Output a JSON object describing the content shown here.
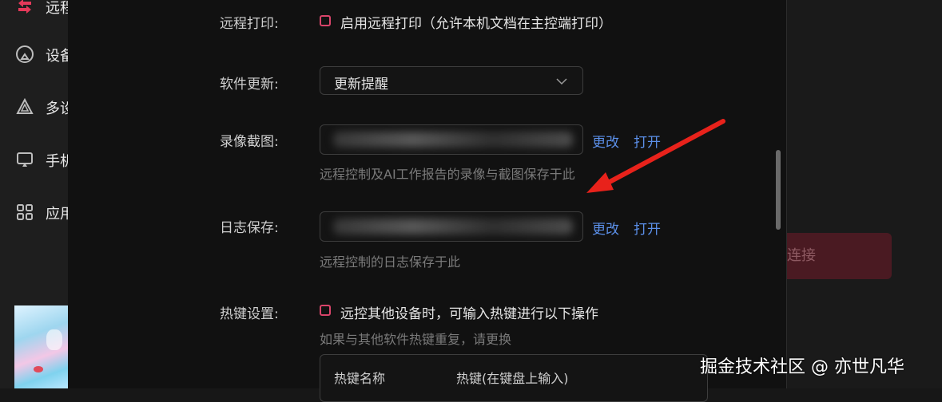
{
  "sidebar": {
    "items": [
      {
        "label": "远程",
        "icon": "remote-arrows-icon",
        "active": true
      },
      {
        "label": "设备",
        "icon": "device-broadcast-icon"
      },
      {
        "label": "多设",
        "icon": "multi-device-triangle-icon"
      },
      {
        "label": "手机",
        "icon": "screen-cast-icon"
      },
      {
        "label": "应用",
        "icon": "apps-grid-icon"
      }
    ]
  },
  "background": {
    "connect_button_label": "连接"
  },
  "settings": {
    "remote_print": {
      "label": "远程打印:",
      "checkbox_text": "启用远程打印（允许本机文档在主控端打印）",
      "checked": false
    },
    "software_update": {
      "label": "软件更新:",
      "selected": "更新提醒"
    },
    "recording": {
      "label": "录像截图:",
      "change": "更改",
      "open": "打开",
      "hint": "远程控制及AI工作报告的录像与截图保存于此"
    },
    "log_save": {
      "label": "日志保存:",
      "change": "更改",
      "open": "打开",
      "hint": "远程控制的日志保存于此"
    },
    "hotkeys": {
      "label": "热键设置:",
      "checkbox_text": "远控其他设备时，可输入热键进行以下操作",
      "checked": false,
      "hint": "如果与其他软件热键重复，请更换",
      "columns": [
        "热键名称",
        "热键(在键盘上输入)"
      ]
    }
  },
  "watermark": "掘金技术社区 @ 亦世凡华",
  "colors": {
    "accent": "#d9446a",
    "link": "#5b8fe8",
    "arrow": "#e8221b",
    "panel_bg": "#111111"
  }
}
